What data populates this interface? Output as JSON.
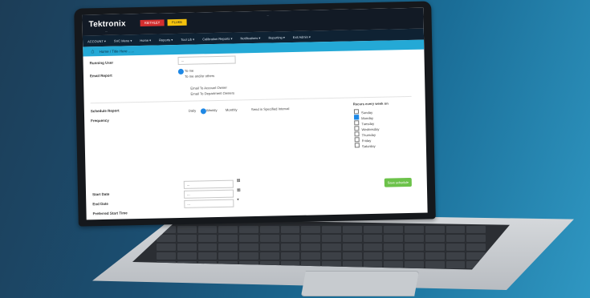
{
  "screen": {
    "brand": "Tektronix",
    "brand_sub": "...",
    "logo_keithley": "KEITHLEY",
    "logo_fluke": "FLUKE",
    "header_meta": "...",
    "nav": [
      "ACCOUNT ▾",
      "SVC Menu ▾",
      "Home ▾",
      "Reports ▾",
      "Tool Lib ▾",
      "Calibration Reports ▾",
      "Notifications ▾",
      "Reporting ▾",
      "Exit Admin ▾"
    ],
    "breadcrumb": "Home / Title Here ......",
    "form": {
      "running_user_label": "Running User",
      "running_user_value": "...",
      "email_report_label": "Email Report",
      "email_opt_me": "To me",
      "email_opt_others": "To me and/or others",
      "email_to_account_owner": "Email To Account Owner",
      "email_to_department_owners": "Email To Department Owners",
      "schedule_report_label": "Schedule Report",
      "frequency_label": "Frequency",
      "freq_daily": "Daily",
      "freq_weekly": "Weekly",
      "freq_monthly": "Monthly",
      "freq_note": "Send in Specified Interval",
      "weekday_header": "Recurs every week on",
      "weekdays": [
        "Sunday",
        "Monday",
        "Tuesday",
        "Wednesday",
        "Thursday",
        "Friday",
        "Saturday"
      ],
      "start_date_label": "Start Date",
      "end_date_label": "End Date",
      "preferred_start_time_label": "Preferred Start Time",
      "start_date_value": "...",
      "end_date_value": "...",
      "start_time_value": "...",
      "submit_label": "Save schedule"
    }
  }
}
